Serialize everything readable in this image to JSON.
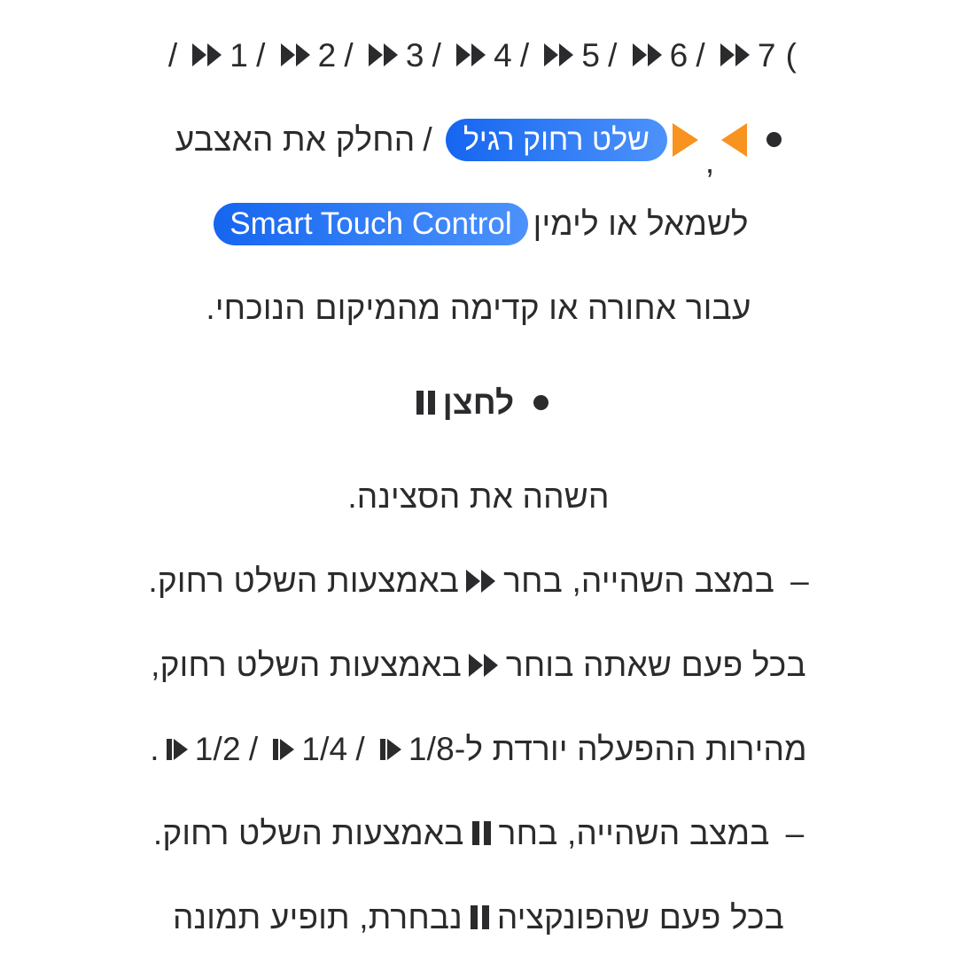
{
  "document": {
    "language": "he",
    "text_color": "#2b2b2d",
    "background": "#ffffff",
    "pill_color_start": "#1565f0",
    "pill_color_end": "#4d92fb",
    "accent_orange": "#f7931e"
  },
  "speed_sequence": {
    "open_paren": "(",
    "slash": "/",
    "items": [
      "7",
      "6",
      "5",
      "4",
      "3",
      "2",
      "1"
    ],
    "icon": "fast-forward-icon"
  },
  "sections": {
    "rewind_forward": {
      "bullet": "•",
      "icon_left": "triangle-left-orange",
      "comma": ",",
      "icon_right": "triangle-right-orange",
      "pill_label": "שלט רחוק רגיל",
      "separator": "/",
      "line1_tail": "החלק את האצבע",
      "line2_head": "לשמאל או לימין",
      "pill2_label": "Smart Touch Control",
      "line3": "עבור אחורה או קדימה מהמיקום הנוכחי."
    },
    "pause": {
      "bullet": "•",
      "heading": "לחצן",
      "heading_icon": "pause-icon",
      "description": "השהה את הסצינה.",
      "items": [
        {
          "dash": "–",
          "pre": "במצב השהייה, בחר",
          "icon": "fast-forward-icon",
          "post": "באמצעות השלט רחוק.",
          "detail_pre": "בכל פעם שאתה בוחר",
          "detail_icon": "fast-forward-icon",
          "detail_post": "באמצעות השלט רחוק,",
          "detail_line2_pre": "מהירות ההפעלה יורדת ל-",
          "detail_fractions": [
            "1/8",
            "1/4",
            "1/2"
          ],
          "detail_fraction_icon": "step-forward-icon",
          "detail_slash": "/",
          "detail_line2_end": "."
        },
        {
          "dash": "–",
          "pre": "במצב השהייה, בחר",
          "icon": "pause-icon",
          "post": "באמצעות השלט רחוק.",
          "detail_pre": "בכל פעם שהפונקציה",
          "detail_icon": "pause-icon",
          "detail_post": "נבחרת, תופיע תמונה"
        }
      ]
    }
  }
}
